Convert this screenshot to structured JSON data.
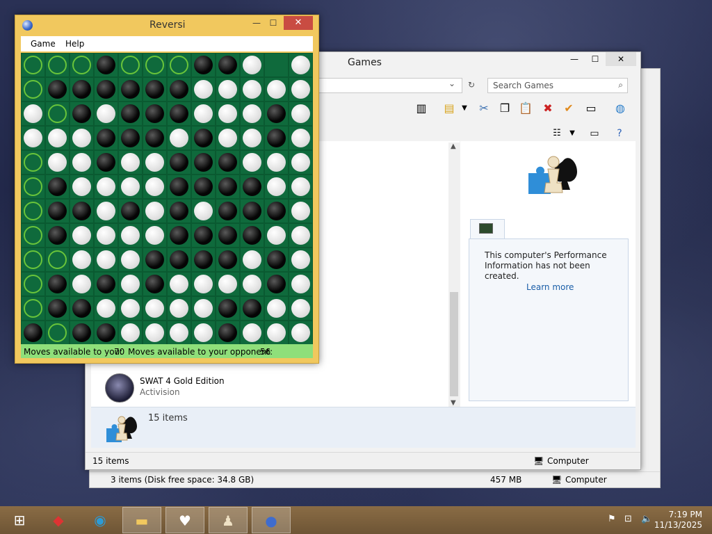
{
  "back_window": {
    "status_left": "3 items (Disk free space: 34.8 GB)",
    "status_size": "457 MB",
    "status_right": "Computer"
  },
  "games_window": {
    "title": "Games",
    "search_placeholder": "Search Games",
    "perf_text": "This computer's Performance Information has not been created.",
    "perf_link": "Learn more",
    "item_name": "SWAT 4 Gold Edition",
    "item_publisher": "Activision",
    "details_count": "15 items",
    "status_left": "15 items",
    "status_right": "Computer"
  },
  "reversi": {
    "title": "Reversi",
    "menu": [
      "Game",
      "Help"
    ],
    "status_you_label": "Moves available to you:",
    "status_you_value": "70",
    "status_opp_label": "Moves available to your opponent:",
    "status_opp_value": "56",
    "board": [
      "mmmbmmmbbw.w",
      "mbbbbbbwwwww",
      "wmbwbbbwwwbw",
      "wwwbbbwbwwbw",
      "mwwbwwbbbwww",
      "mbwwwwbbbbww",
      "mbbwbwbwbbbw",
      "mbwwwwbbbbww",
      "mmwwwbbbbwbw",
      "mbwbwbwwwwbw",
      "mbbwwwwwbbww",
      "bmbbwwwwbwww"
    ]
  },
  "taskbar": {
    "time": "7:19 PM",
    "date": "11/13/2025"
  }
}
